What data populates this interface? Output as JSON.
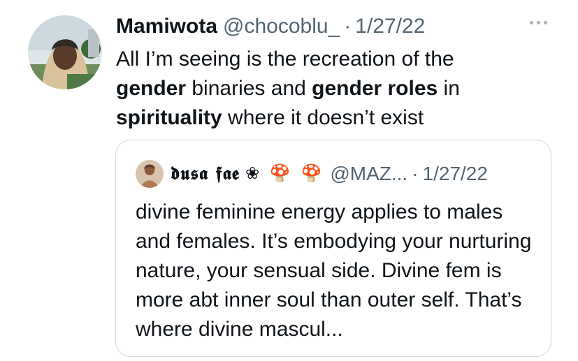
{
  "tweet": {
    "display_name": "Mamiwota",
    "handle": "@chocoblu_",
    "separator": "·",
    "date": "1/27/22",
    "more_icon": "more-horizontal-icon",
    "text_segments": [
      {
        "text": "All I’m seeing is the recreation of the ",
        "bold": false
      },
      {
        "text": "gender",
        "bold": true
      },
      {
        "text": " binaries and ",
        "bold": false
      },
      {
        "text": "gender roles",
        "bold": true
      },
      {
        "text": " in ",
        "bold": false
      },
      {
        "text": "spirituality",
        "bold": true
      },
      {
        "text": " where it doesn’t exist",
        "bold": false
      }
    ]
  },
  "quoted_tweet": {
    "display_name": "𝖉𝖚𝖘𝖆 𝖋𝖆𝖊",
    "name_decorations": "❀ 🍄 🍄",
    "handle": "@MAZ...",
    "separator": "·",
    "date": "1/27/22",
    "text": "divine feminine energy applies to males and females. It’s embodying your nurturing nature, your sensual side. Divine fem is more abt inner soul than outer self. That’s where divine mascul..."
  },
  "colors": {
    "primary_text": "#0f1419",
    "secondary_text": "#536471",
    "border": "#cfd9de"
  }
}
